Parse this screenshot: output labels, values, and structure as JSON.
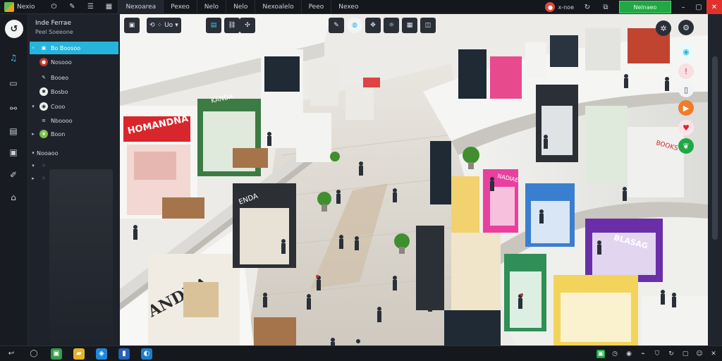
{
  "app": {
    "name": "Nexio"
  },
  "topbar": {
    "menus": [
      "Nexoarea",
      "Pexeo",
      "Nelo",
      "Nelo",
      "Nexoalelo",
      "Peeo",
      "Nexeo"
    ],
    "right_label": "x-noe",
    "action_button": "Nelnaeo"
  },
  "sidebar": {
    "title": "Inde Ferrae",
    "subtitle": "Peel Soeeone",
    "items": [
      {
        "label": "Bo Boosoo"
      },
      {
        "label": "Nosooo"
      },
      {
        "label": "Booeo"
      },
      {
        "label": "Bosbo"
      },
      {
        "label": "Cooo"
      },
      {
        "label": "Nboooo"
      },
      {
        "label": "Boon"
      },
      {
        "label": "Nooaoo"
      }
    ]
  },
  "viewport": {
    "toolbar_label": "Uo"
  },
  "scene": {
    "store_signs": [
      "HOMANDNA",
      "KANDA",
      "ANDNA",
      "NADIAE",
      "BLASAG"
    ]
  },
  "colors": {
    "accent": "#25b5dc",
    "action_green": "#1fa844",
    "close_red": "#e0322b"
  }
}
